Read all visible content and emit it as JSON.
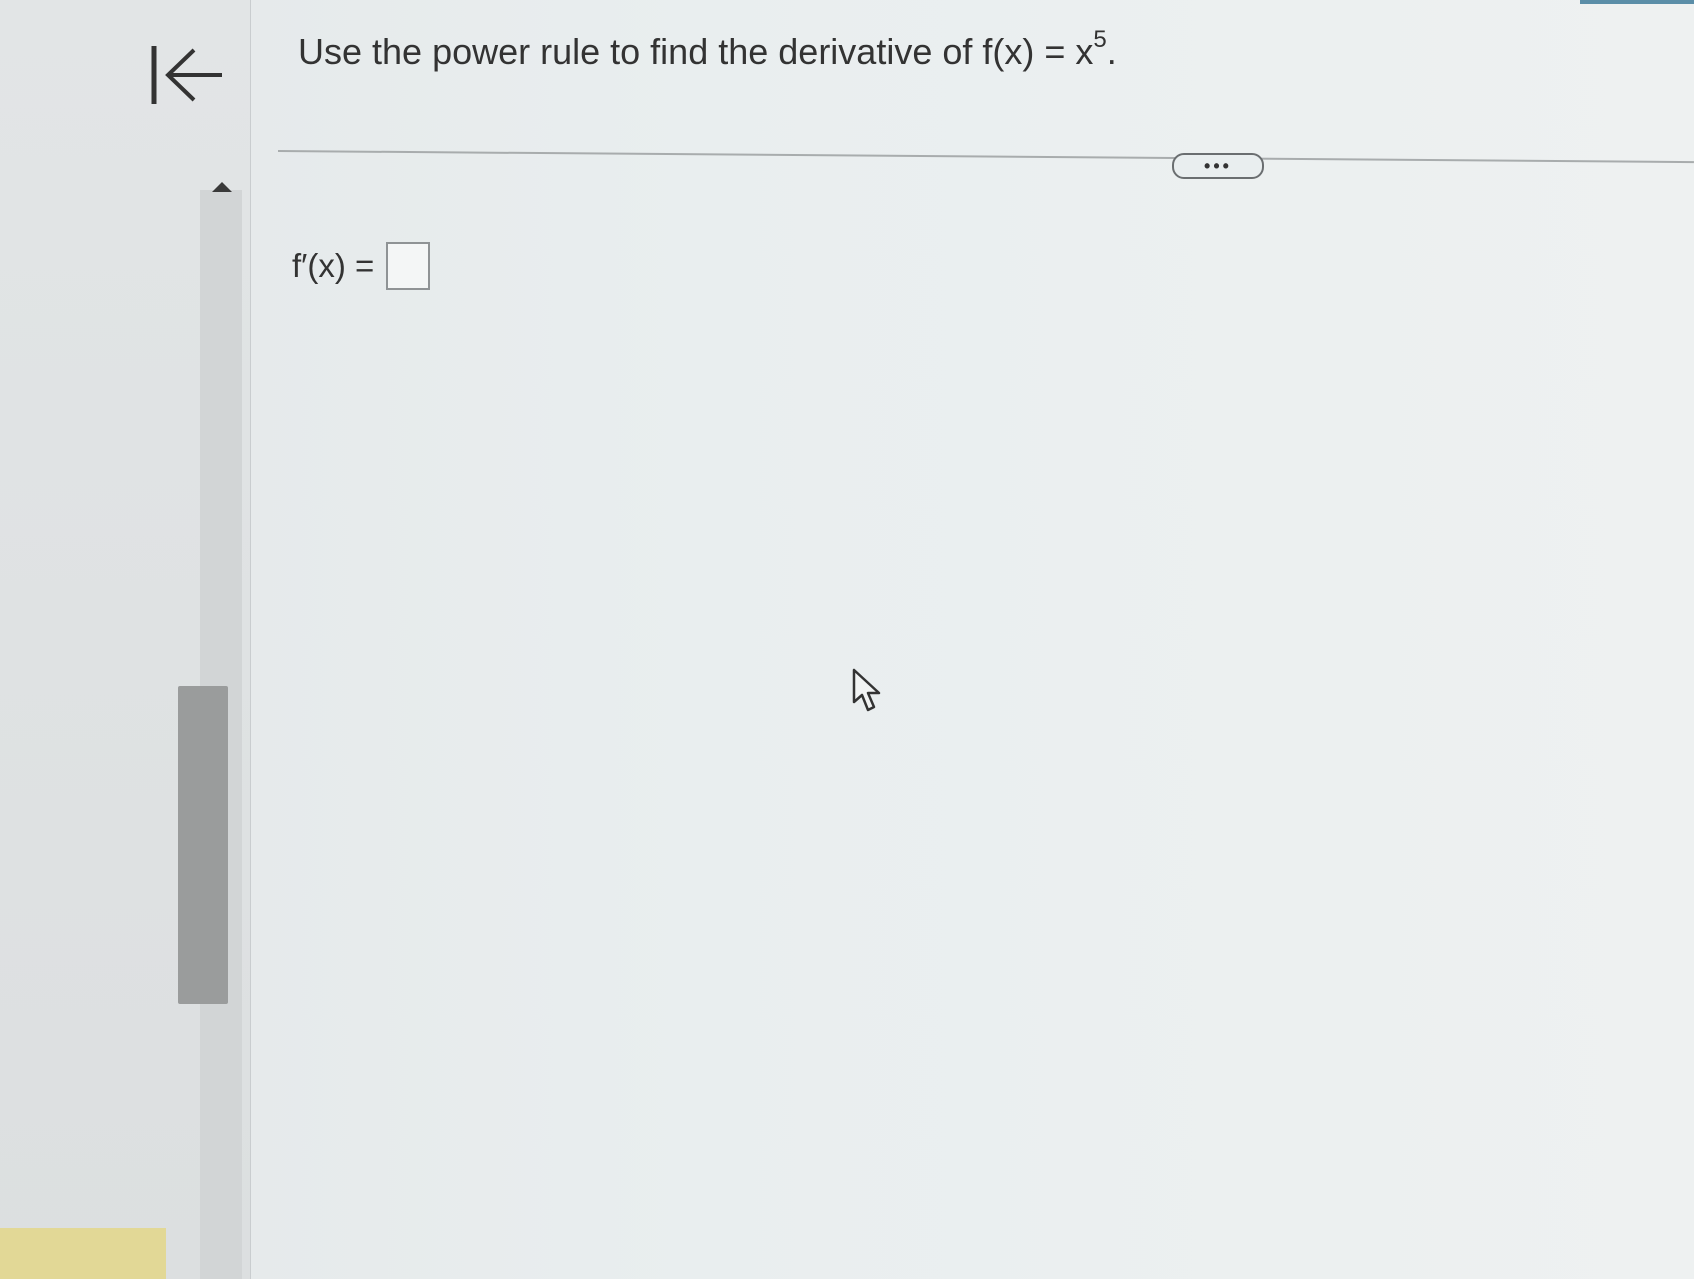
{
  "nav": {
    "back_icon": "arrow-left-to-bar-icon"
  },
  "question": {
    "prefix": "Use the power rule to find the derivative of f(x) = x",
    "exponent": "5",
    "suffix": "."
  },
  "toolbar": {
    "more_label": "•••"
  },
  "answer": {
    "label": "f′(x) =",
    "value": ""
  },
  "colors": {
    "accent": "#5b8ea8",
    "highlight": "#e2d896"
  }
}
